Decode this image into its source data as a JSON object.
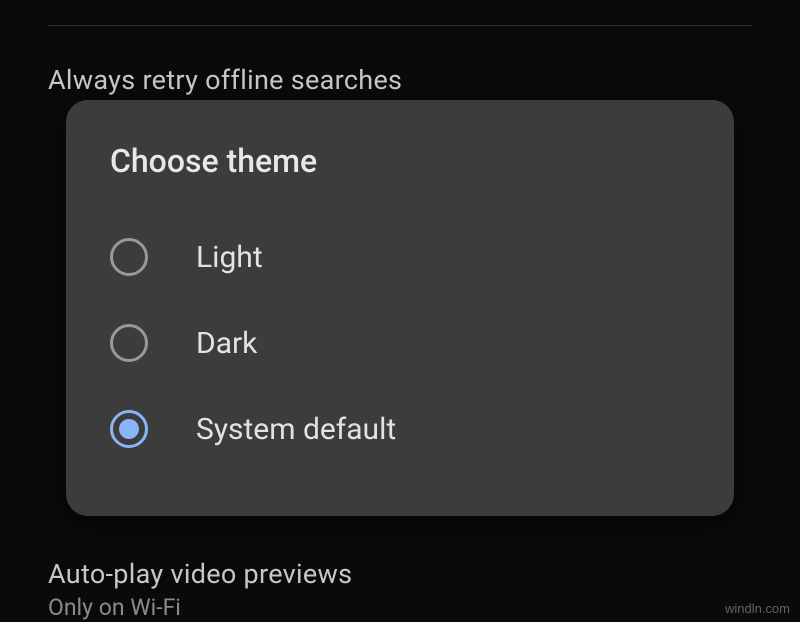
{
  "background": {
    "item_top": {
      "title": "Always retry offline searches"
    },
    "item_bottom": {
      "title": "Auto-play video previews",
      "subtitle": "Only on Wi-Fi"
    }
  },
  "dialog": {
    "title": "Choose theme",
    "options": [
      {
        "label": "Light",
        "selected": false
      },
      {
        "label": "Dark",
        "selected": false
      },
      {
        "label": "System default",
        "selected": true
      }
    ]
  },
  "watermark": "windln.com"
}
